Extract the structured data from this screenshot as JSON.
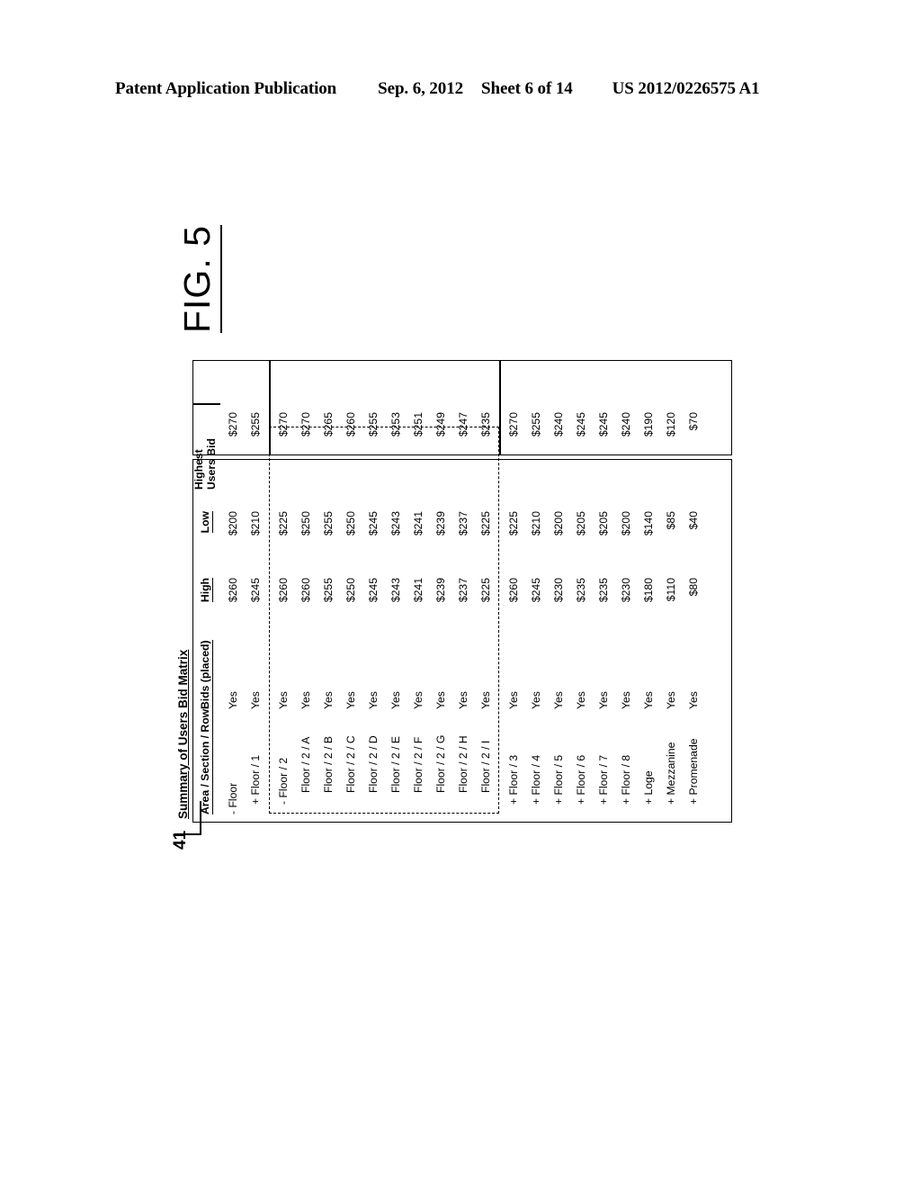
{
  "header": {
    "publication": "Patent Application Publication",
    "date": "Sep. 6, 2012",
    "sheet": "Sheet 6 of 14",
    "number": "US 2012/0226575 A1"
  },
  "figure": {
    "label": "FIG. 5",
    "reference_numeral": "41",
    "title": "Summary of Users Bid Matrix"
  },
  "table": {
    "columns": [
      {
        "key": "area",
        "label": "Area / Section / Row"
      },
      {
        "key": "bids",
        "label": "Bids (placed)"
      },
      {
        "key": "high",
        "label": "High"
      },
      {
        "key": "low",
        "label": "Low"
      },
      {
        "key": "highest",
        "label_line1": "Highest",
        "label_line2": "Users Bid"
      }
    ],
    "rows": [
      {
        "area": "- Floor",
        "indent": 0,
        "bids": "Yes",
        "high": "$260",
        "low": "$200",
        "highest": "$270"
      },
      {
        "area": "+ Floor / 1",
        "indent": 1,
        "bids": "Yes",
        "high": "$245",
        "low": "$210",
        "highest": "$255"
      },
      {
        "area": "- Floor / 2",
        "indent": 1,
        "bids": "Yes",
        "high": "$260",
        "low": "$225",
        "highest": "$270"
      },
      {
        "area": "Floor / 2 / A",
        "indent": 2,
        "bids": "Yes",
        "high": "$260",
        "low": "$250",
        "highest": "$270"
      },
      {
        "area": "Floor / 2 / B",
        "indent": 2,
        "bids": "Yes",
        "high": "$255",
        "low": "$255",
        "highest": "$265"
      },
      {
        "area": "Floor / 2 / C",
        "indent": 2,
        "bids": "Yes",
        "high": "$250",
        "low": "$250",
        "highest": "$260"
      },
      {
        "area": "Floor / 2 / D",
        "indent": 2,
        "bids": "Yes",
        "high": "$245",
        "low": "$245",
        "highest": "$255"
      },
      {
        "area": "Floor / 2 / E",
        "indent": 2,
        "bids": "Yes",
        "high": "$243",
        "low": "$243",
        "highest": "$253"
      },
      {
        "area": "Floor / 2 / F",
        "indent": 2,
        "bids": "Yes",
        "high": "$241",
        "low": "$241",
        "highest": "$251"
      },
      {
        "area": "Floor / 2 / G",
        "indent": 2,
        "bids": "Yes",
        "high": "$239",
        "low": "$239",
        "highest": "$249"
      },
      {
        "area": "Floor / 2 / H",
        "indent": 2,
        "bids": "Yes",
        "high": "$237",
        "low": "$237",
        "highest": "$247"
      },
      {
        "area": "Floor / 2 / I",
        "indent": 2,
        "bids": "Yes",
        "high": "$225",
        "low": "$225",
        "highest": "$235"
      },
      {
        "area": "+ Floor / 3",
        "indent": 1,
        "bids": "Yes",
        "high": "$260",
        "low": "$225",
        "highest": "$270"
      },
      {
        "area": "+ Floor / 4",
        "indent": 1,
        "bids": "Yes",
        "high": "$245",
        "low": "$210",
        "highest": "$255"
      },
      {
        "area": "+ Floor / 5",
        "indent": 1,
        "bids": "Yes",
        "high": "$230",
        "low": "$200",
        "highest": "$240"
      },
      {
        "area": "+ Floor / 6",
        "indent": 1,
        "bids": "Yes",
        "high": "$235",
        "low": "$205",
        "highest": "$245"
      },
      {
        "area": "+ Floor / 7",
        "indent": 1,
        "bids": "Yes",
        "high": "$235",
        "low": "$205",
        "highest": "$245"
      },
      {
        "area": "+ Floor / 8",
        "indent": 1,
        "bids": "Yes",
        "high": "$230",
        "low": "$200",
        "highest": "$240"
      },
      {
        "area": "+ Loge",
        "indent": 1,
        "bids": "Yes",
        "high": "$180",
        "low": "$140",
        "highest": "$190"
      },
      {
        "area": "+ Mezzanine",
        "indent": 1,
        "bids": "Yes",
        "high": "$110",
        "low": "$85",
        "highest": "$120"
      },
      {
        "area": "+ Promenade",
        "indent": 1,
        "bids": "Yes",
        "high": "$80",
        "low": "$40",
        "highest": "$70"
      }
    ],
    "group_highlight": {
      "first_row_index": 2,
      "last_row_index": 11
    }
  }
}
